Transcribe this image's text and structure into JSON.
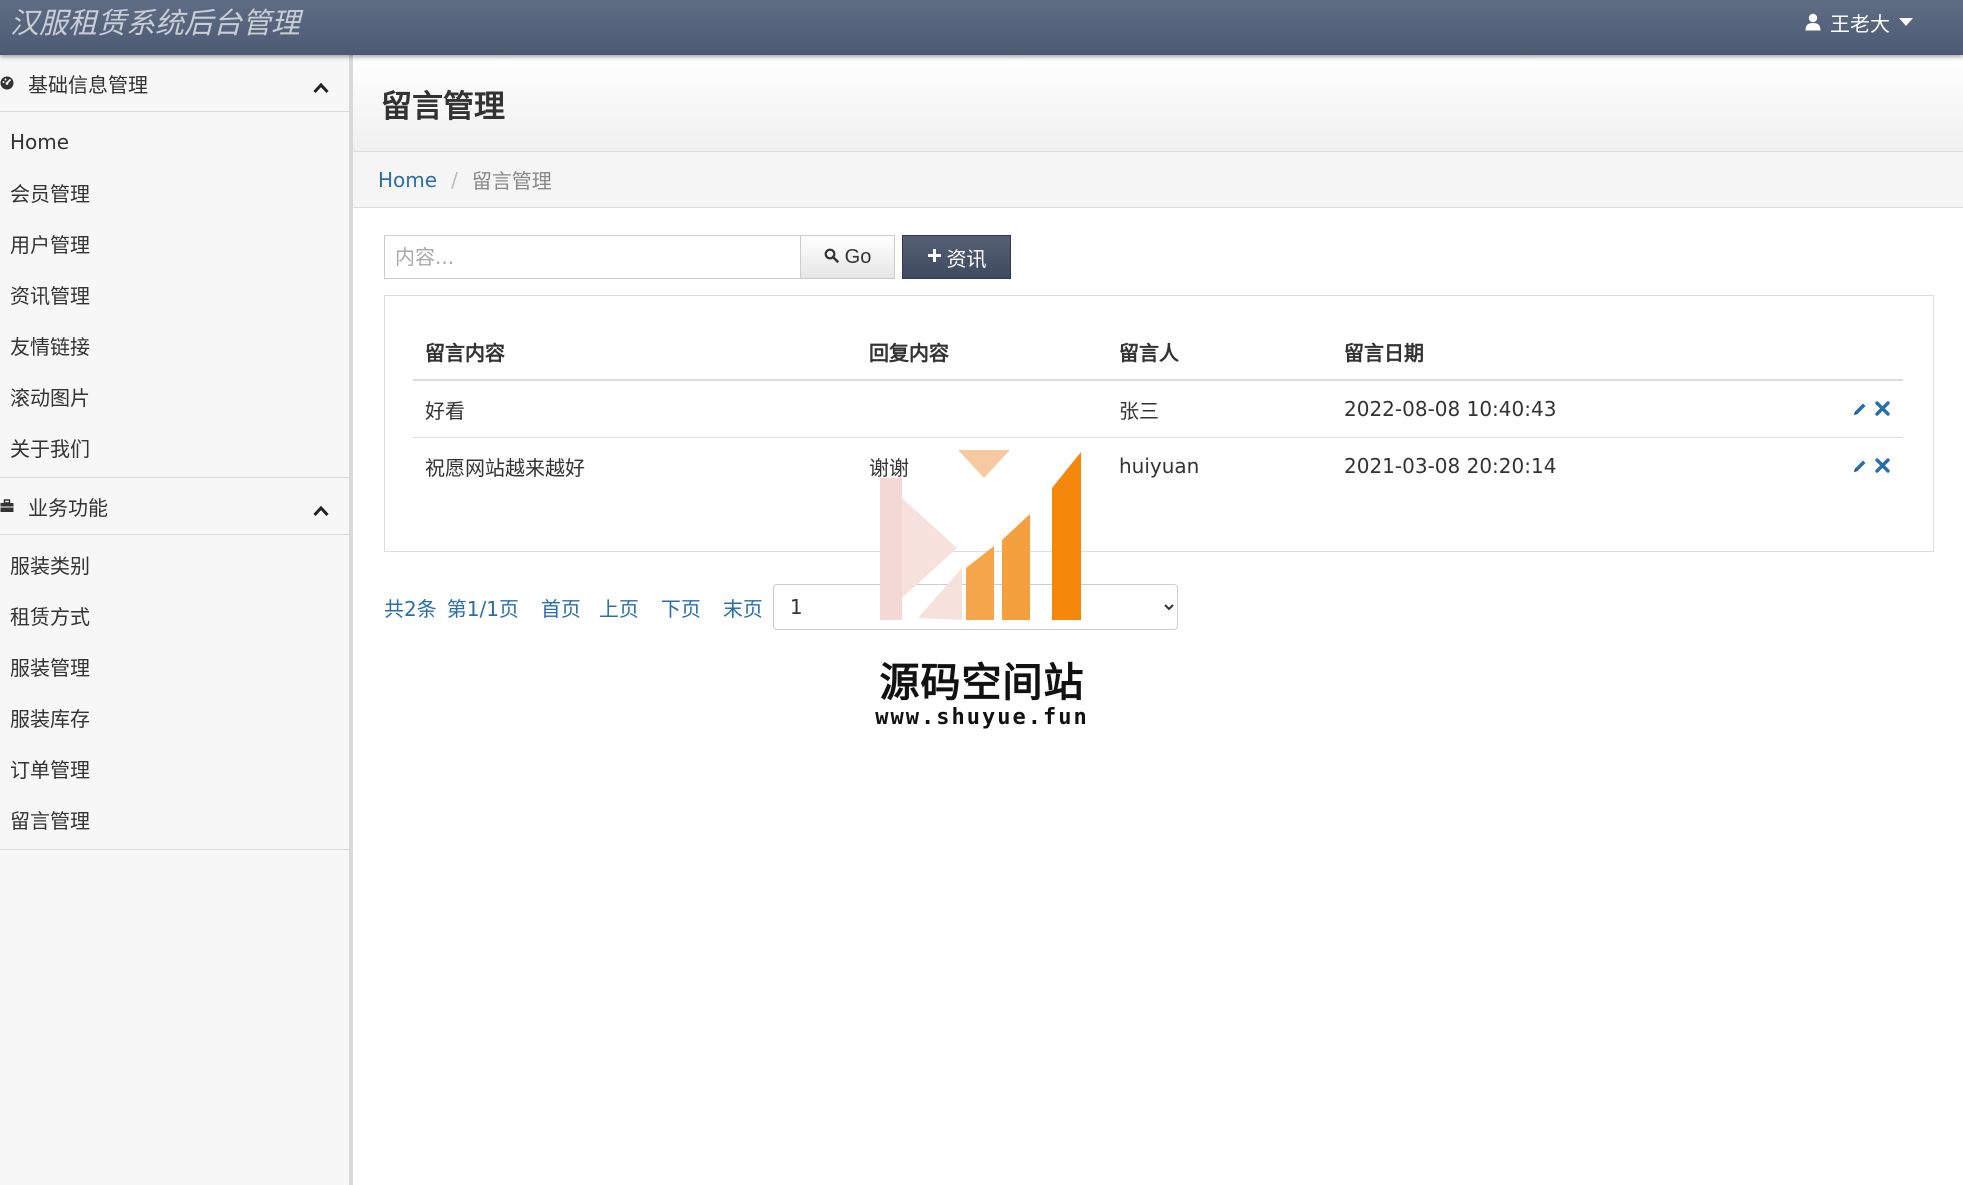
{
  "app": {
    "title": "汉服租赁系统后台管理",
    "user_name": "王老大",
    "user_icon": "user-icon",
    "accent_color": "#4c5a73"
  },
  "sidebar": {
    "groups": [
      {
        "title": "基础信息管理",
        "icon": "dashboard-icon",
        "items": [
          "Home",
          "会员管理",
          "用户管理",
          "资讯管理",
          "友情链接",
          "滚动图片",
          "关于我们"
        ]
      },
      {
        "title": "业务功能",
        "icon": "briefcase-icon",
        "items": [
          "服装类别",
          "租赁方式",
          "服装管理",
          "服装库存",
          "订单管理",
          "留言管理"
        ]
      }
    ]
  },
  "page": {
    "title": "留言管理",
    "breadcrumb": {
      "home": "Home",
      "current": "留言管理"
    }
  },
  "toolbar": {
    "search_placeholder": "内容...",
    "go_label": "Go",
    "add_label": "资讯"
  },
  "table": {
    "headers": [
      "留言内容",
      "回复内容",
      "留言人",
      "留言日期"
    ],
    "rows": [
      [
        "好看",
        "",
        "张三",
        "2022-08-08 10:40:43"
      ],
      [
        "祝愿网站越来越好",
        "谢谢",
        "huiyuan",
        "2021-03-08 20:20:14"
      ]
    ]
  },
  "pager": {
    "summary": "共2条",
    "page_info": "第1/1页",
    "first": "首页",
    "prev": "上页",
    "next": "下页",
    "last": "末页",
    "selected_page": "1"
  },
  "watermark": {
    "name": "源码空间站",
    "url": "www.shuyue.fun"
  }
}
